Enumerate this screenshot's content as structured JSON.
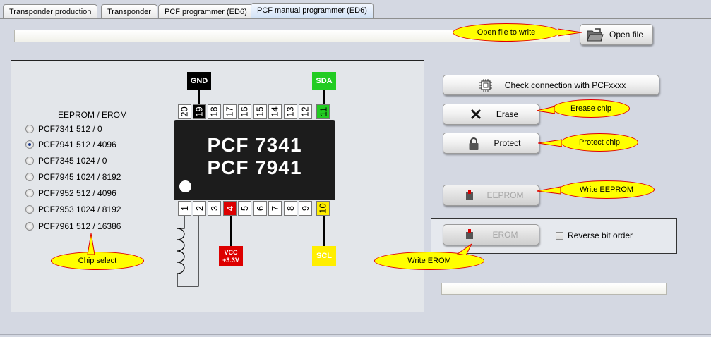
{
  "tabs": [
    {
      "label": "Transponder production",
      "active": false
    },
    {
      "label": "Transponder",
      "active": false
    },
    {
      "label": "PCF programmer (ED6)",
      "active": false
    },
    {
      "label": "PCF manual programmer (ED6)",
      "active": true
    }
  ],
  "file": {
    "path_value": "",
    "open_label": "Open file"
  },
  "chip": {
    "title_line1": "PCF 7341",
    "title_line2": "PCF 7941",
    "top_pins": [
      "20",
      "19",
      "18",
      "17",
      "16",
      "15",
      "14",
      "13",
      "12",
      "11"
    ],
    "bottom_pins": [
      "1",
      "2",
      "3",
      "4",
      "5",
      "6",
      "7",
      "8",
      "9",
      "10"
    ],
    "gnd_label": "GND",
    "sda_label": "SDA",
    "vcc_label_1": "VCC",
    "vcc_label_2": "+3.3V",
    "scl_label": "SCL"
  },
  "chip_select": {
    "header": "EEPROM / EROM",
    "selected": "PCF7941",
    "options": [
      {
        "label": "PCF7341  512 / 0"
      },
      {
        "label": "PCF7941  512 / 4096"
      },
      {
        "label": "PCF7345  1024 / 0"
      },
      {
        "label": "PCF7945  1024 / 8192"
      },
      {
        "label": "PCF7952  512 / 4096"
      },
      {
        "label": "PCF7953  1024 / 8192"
      },
      {
        "label": "PCF7961  512 / 16386"
      }
    ]
  },
  "actions": {
    "check_connection": "Check connection with PCFxxxx",
    "erase": "Erase",
    "protect": "Protect",
    "write_eeprom": "EEPROM",
    "write_erom": "EROM",
    "reverse_bit_order": "Reverse bit order"
  },
  "status": {
    "value": ""
  },
  "callouts": {
    "open_file": "Open file to write",
    "erase_chip": "Erease chip",
    "protect_chip": "Protect chip",
    "write_eeprom": "Write EEPROM",
    "write_erom": "Write EROM",
    "chip_select": "Chip select"
  },
  "colors": {
    "gnd": "#000000",
    "sda": "#00cc00",
    "vcc": "#e00000",
    "scl": "#ffee00",
    "callout_fill": "#ffff00",
    "callout_border": "#e00000"
  }
}
